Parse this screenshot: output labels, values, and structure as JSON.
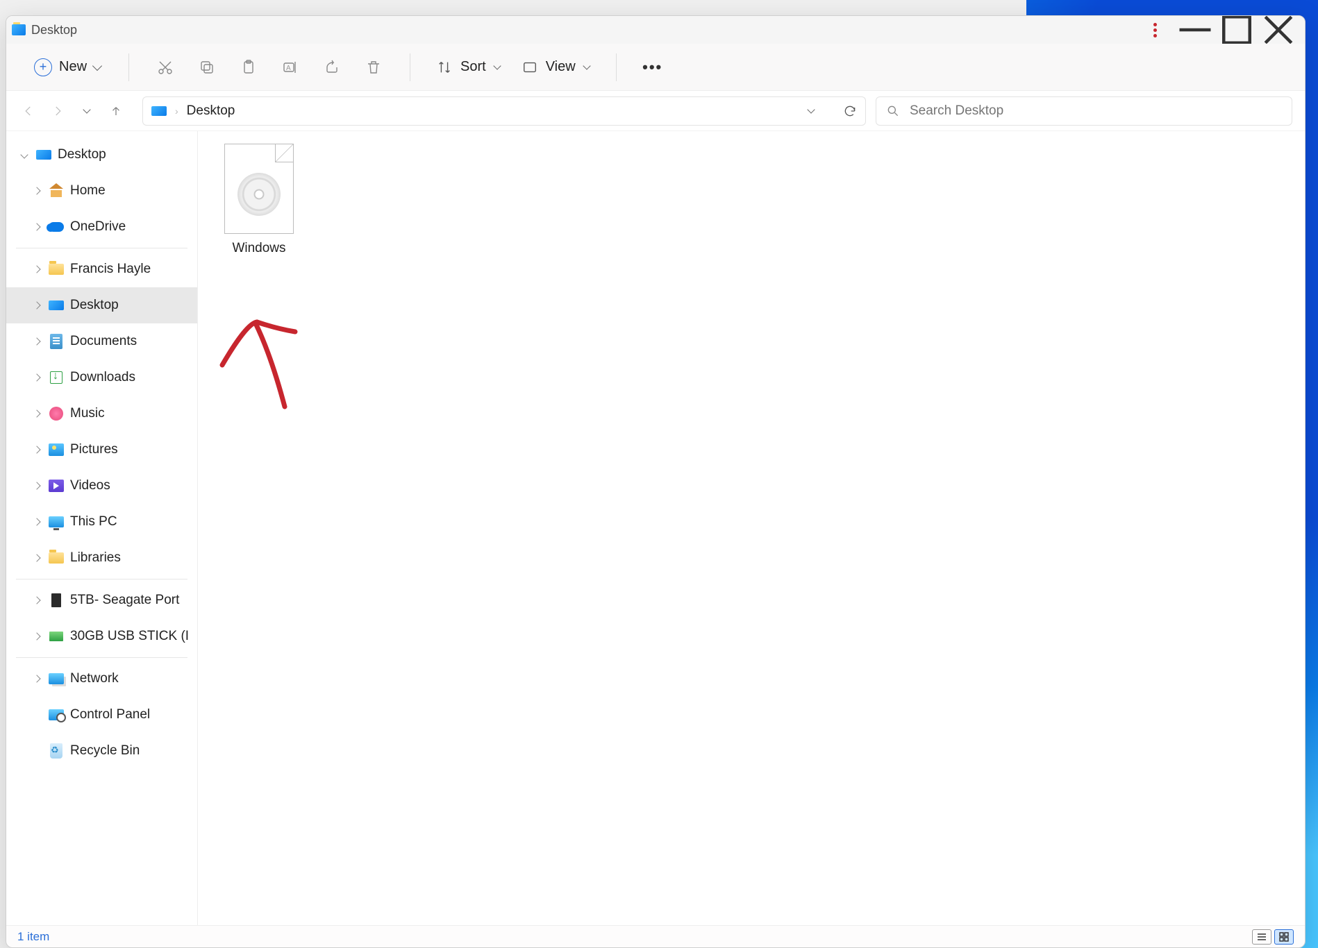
{
  "window": {
    "title": "Desktop"
  },
  "toolbar": {
    "new_label": "New",
    "sort_label": "Sort",
    "view_label": "View"
  },
  "address": {
    "crumb_root": "",
    "crumb_current": "Desktop"
  },
  "search": {
    "placeholder": "Search Desktop"
  },
  "sidebar": {
    "root": "Desktop",
    "items": [
      {
        "label": "Home"
      },
      {
        "label": "OneDrive"
      }
    ],
    "user_section": [
      {
        "label": "Francis Hayle"
      },
      {
        "label": "Desktop"
      },
      {
        "label": "Documents"
      },
      {
        "label": "Downloads"
      },
      {
        "label": "Music"
      },
      {
        "label": "Pictures"
      },
      {
        "label": "Videos"
      },
      {
        "label": "This PC"
      },
      {
        "label": "Libraries"
      }
    ],
    "drives": [
      {
        "label": "5TB- Seagate Port"
      },
      {
        "label": "30GB USB STICK (I"
      }
    ],
    "system": [
      {
        "label": "Network"
      },
      {
        "label": "Control Panel"
      },
      {
        "label": "Recycle Bin"
      }
    ]
  },
  "content": {
    "files": [
      {
        "name": "Windows"
      }
    ]
  },
  "status": {
    "count_text": "1 item"
  }
}
